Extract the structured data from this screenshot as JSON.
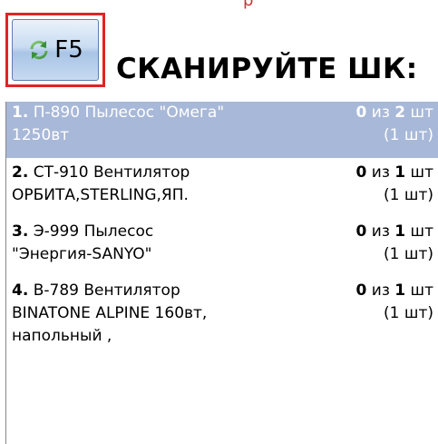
{
  "header": {
    "clipped_text": "р",
    "f5_button_label": "F5",
    "refresh_icon": "refresh-icon",
    "title": "СКАНИРУЙТЕ ШК:"
  },
  "colors": {
    "highlight_border": "#e02424",
    "selected_row_bg": "#a8b8d8"
  },
  "items": [
    {
      "index": "1.",
      "code": "П-890",
      "line1": "Пылесос \"Омега\"",
      "line2": "1250вт",
      "line3": "",
      "scanned": "0",
      "of": "из",
      "total": "2",
      "unit": "шт",
      "pack": "(1 шт)",
      "selected": true
    },
    {
      "index": "2.",
      "code": "СТ-910",
      "line1": "Вентилятор",
      "line2": "ОРБИТА,STERLING,ЯП.",
      "line3": "",
      "scanned": "0",
      "of": "из",
      "total": "1",
      "unit": "шт",
      "pack": "(1 шт)",
      "selected": false
    },
    {
      "index": "3.",
      "code": "Э-999",
      "line1": "Пылесос",
      "line2": "\"Энергия-SANYO\"",
      "line3": "",
      "scanned": "0",
      "of": "из",
      "total": "1",
      "unit": "шт",
      "pack": "(1 шт)",
      "selected": false
    },
    {
      "index": "4.",
      "code": "В-789",
      "line1": "Вентилятор",
      "line2": "BINATONE ALPINE 160вт,",
      "line3": "напольный ,",
      "scanned": "0",
      "of": "из",
      "total": "1",
      "unit": "шт",
      "pack": "(1 шт)",
      "selected": false
    }
  ]
}
